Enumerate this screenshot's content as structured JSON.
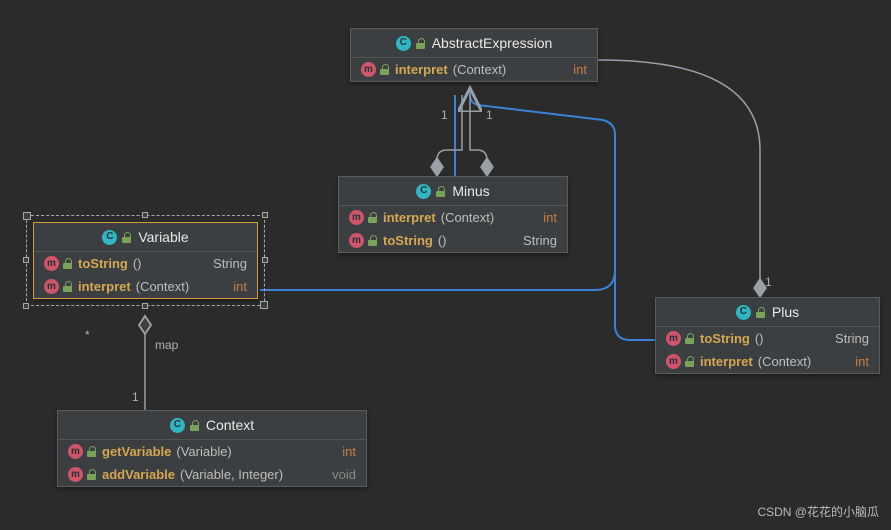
{
  "watermark": "CSDN @花花的小脑瓜",
  "classes": {
    "abstractExpression": {
      "title": "AbstractExpression",
      "members": [
        {
          "name": "interpret",
          "params": "(Context)",
          "ret": "int",
          "retClass": "ret-int"
        }
      ]
    },
    "variable": {
      "title": "Variable",
      "members": [
        {
          "name": "toString",
          "params": "()",
          "ret": "String",
          "retClass": "ret-string"
        },
        {
          "name": "interpret",
          "params": "(Context)",
          "ret": "int",
          "retClass": "ret-int"
        }
      ]
    },
    "minus": {
      "title": "Minus",
      "members": [
        {
          "name": "interpret",
          "params": "(Context)",
          "ret": "int",
          "retClass": "ret-int"
        },
        {
          "name": "toString",
          "params": "()",
          "ret": "String",
          "retClass": "ret-string"
        }
      ]
    },
    "plus": {
      "title": "Plus",
      "members": [
        {
          "name": "toString",
          "params": "()",
          "ret": "String",
          "retClass": "ret-string"
        },
        {
          "name": "interpret",
          "params": "(Context)",
          "ret": "int",
          "retClass": "ret-int"
        }
      ]
    },
    "context": {
      "title": "Context",
      "members": [
        {
          "name": "getVariable",
          "params": "(Variable)",
          "ret": "int",
          "retClass": "ret-int"
        },
        {
          "name": "addVariable",
          "params": "(Variable, Integer)",
          "ret": "void",
          "retClass": "ret-void"
        }
      ]
    }
  },
  "edgeLabels": {
    "minusToAE_left": "1",
    "minusToAE_right": "1",
    "plusToAE": "1",
    "variableStar": "*",
    "variableMap": "map",
    "contextOne": "1"
  },
  "chart_data": {
    "type": "uml-class-diagram",
    "classes": [
      {
        "name": "AbstractExpression",
        "stereotype": "class",
        "methods": [
          {
            "name": "interpret",
            "params": [
              "Context"
            ],
            "return": "int"
          }
        ]
      },
      {
        "name": "Variable",
        "stereotype": "class",
        "methods": [
          {
            "name": "toString",
            "params": [],
            "return": "String"
          },
          {
            "name": "interpret",
            "params": [
              "Context"
            ],
            "return": "int"
          }
        ]
      },
      {
        "name": "Minus",
        "stereotype": "class",
        "methods": [
          {
            "name": "interpret",
            "params": [
              "Context"
            ],
            "return": "int"
          },
          {
            "name": "toString",
            "params": [],
            "return": "String"
          }
        ]
      },
      {
        "name": "Plus",
        "stereotype": "class",
        "methods": [
          {
            "name": "toString",
            "params": [],
            "return": "String"
          },
          {
            "name": "interpret",
            "params": [
              "Context"
            ],
            "return": "int"
          }
        ]
      },
      {
        "name": "Context",
        "stereotype": "class",
        "methods": [
          {
            "name": "getVariable",
            "params": [
              "Variable"
            ],
            "return": "int"
          },
          {
            "name": "addVariable",
            "params": [
              "Variable",
              "Integer"
            ],
            "return": "void"
          }
        ]
      }
    ],
    "relationships": [
      {
        "from": "Variable",
        "to": "AbstractExpression",
        "type": "generalization"
      },
      {
        "from": "Minus",
        "to": "AbstractExpression",
        "type": "generalization"
      },
      {
        "from": "Plus",
        "to": "AbstractExpression",
        "type": "generalization"
      },
      {
        "from": "Minus",
        "to": "AbstractExpression",
        "type": "aggregation",
        "multiplicity": {
          "to": "1"
        }
      },
      {
        "from": "Plus",
        "to": "AbstractExpression",
        "type": "aggregation",
        "multiplicity": {
          "to": "1"
        }
      },
      {
        "from": "Context",
        "to": "Variable",
        "type": "association",
        "role": "map",
        "multiplicity": {
          "from": "1",
          "to": "*"
        }
      }
    ]
  }
}
